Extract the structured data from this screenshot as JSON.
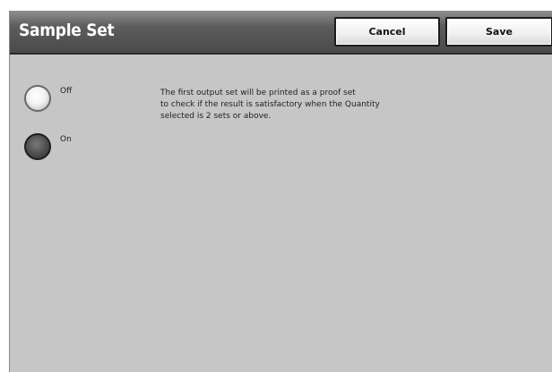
{
  "header": {
    "title": "Sample Set"
  },
  "buttons": {
    "cancel_label": "Cancel",
    "save_label": "Save"
  },
  "options": [
    {
      "label": "Off",
      "selected": false
    },
    {
      "label": "On",
      "selected": true
    }
  ],
  "description": {
    "lines": [
      "The first output set will be printed as a proof set",
      "to check if the result is satisfactory when the Quantity",
      "selected is 2 sets or above."
    ]
  }
}
